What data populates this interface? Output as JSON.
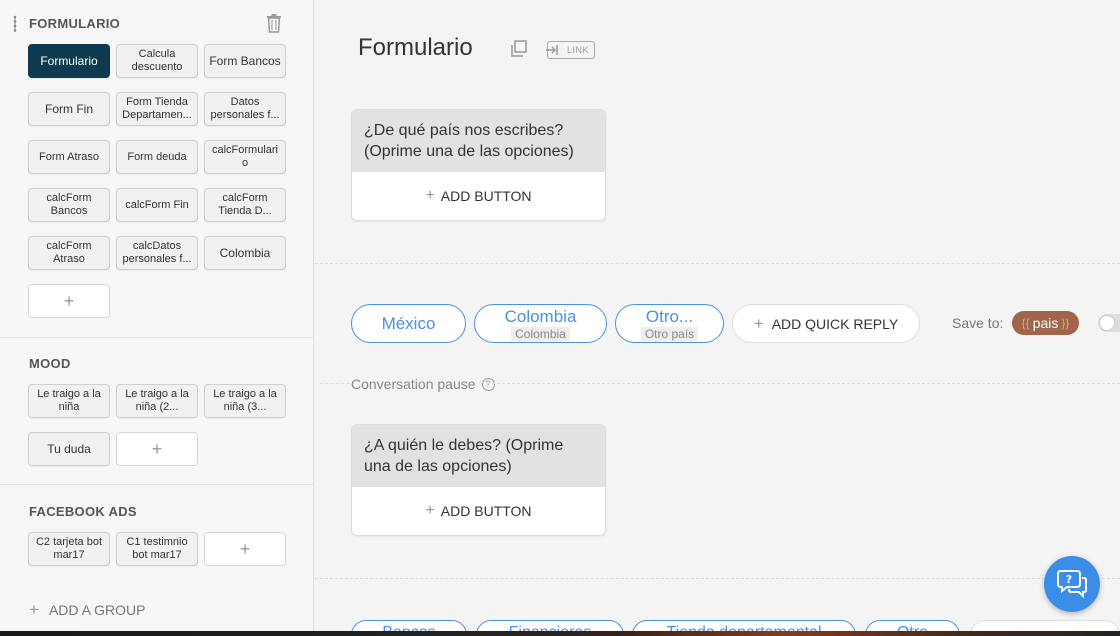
{
  "sidebar": {
    "groups": [
      {
        "title": "FORMULARIO",
        "blocks": [
          "Formulario",
          "Calcula descuento",
          "Form Bancos",
          "Form Fin",
          "Form Tienda Departamen...",
          "Datos personales f...",
          "Form Atraso",
          "Form deuda",
          "calcFormulario",
          "calcForm Bancos",
          "calcForm Fin",
          "calcForm Tienda D...",
          "calcForm Atraso",
          "calcDatos personales f...",
          "Colombia"
        ],
        "add_label": "+"
      },
      {
        "title": "MOOD",
        "blocks": [
          "Le traigo a la niña",
          "Le traigo a la niña (2...",
          "Le traigo a la niña (3...",
          "Tu duda"
        ],
        "add_label": "+"
      },
      {
        "title": "FACEBOOK ADS",
        "blocks": [
          "C2 tarjeta bot mar17",
          "C1 testimnio bot mar17"
        ],
        "add_label": "+"
      }
    ],
    "add_group_label": "ADD A GROUP"
  },
  "main": {
    "title": "Formulario",
    "link_label": "LINK",
    "cards": [
      {
        "text": "¿De qué país nos escribes? (Oprime una de las opciones)",
        "add_button_label": "ADD BUTTON"
      },
      {
        "text": "¿A quién le debes? (Oprime una de las opciones)",
        "add_button_label": "ADD BUTTON"
      }
    ],
    "quick_replies": [
      {
        "title": "México",
        "subtitle": ""
      },
      {
        "title": "Colombia",
        "subtitle": "Colombia"
      },
      {
        "title": "Otro...",
        "subtitle": "Otro país"
      }
    ],
    "add_quick_reply_label": "ADD QUICK REPLY",
    "save_to_label": "Save to:",
    "save_to_variable": "pais",
    "conversation_pause_label": "Conversation pause",
    "bottom_quick_replies": [
      "Bancos",
      "Financieras",
      "Tienda departamental",
      "Otro"
    ]
  },
  "colors": {
    "active_block": "#0d3a4e",
    "quick_reply_blue": "#4a90e2",
    "variable_pill": "#a0654a",
    "help_fab": "#3b8ee8"
  },
  "icons": [
    "drag-handle-icon",
    "trash-icon",
    "plus-icon",
    "copy-icon",
    "link-icon",
    "help-circle-icon",
    "chat-help-icon"
  ]
}
